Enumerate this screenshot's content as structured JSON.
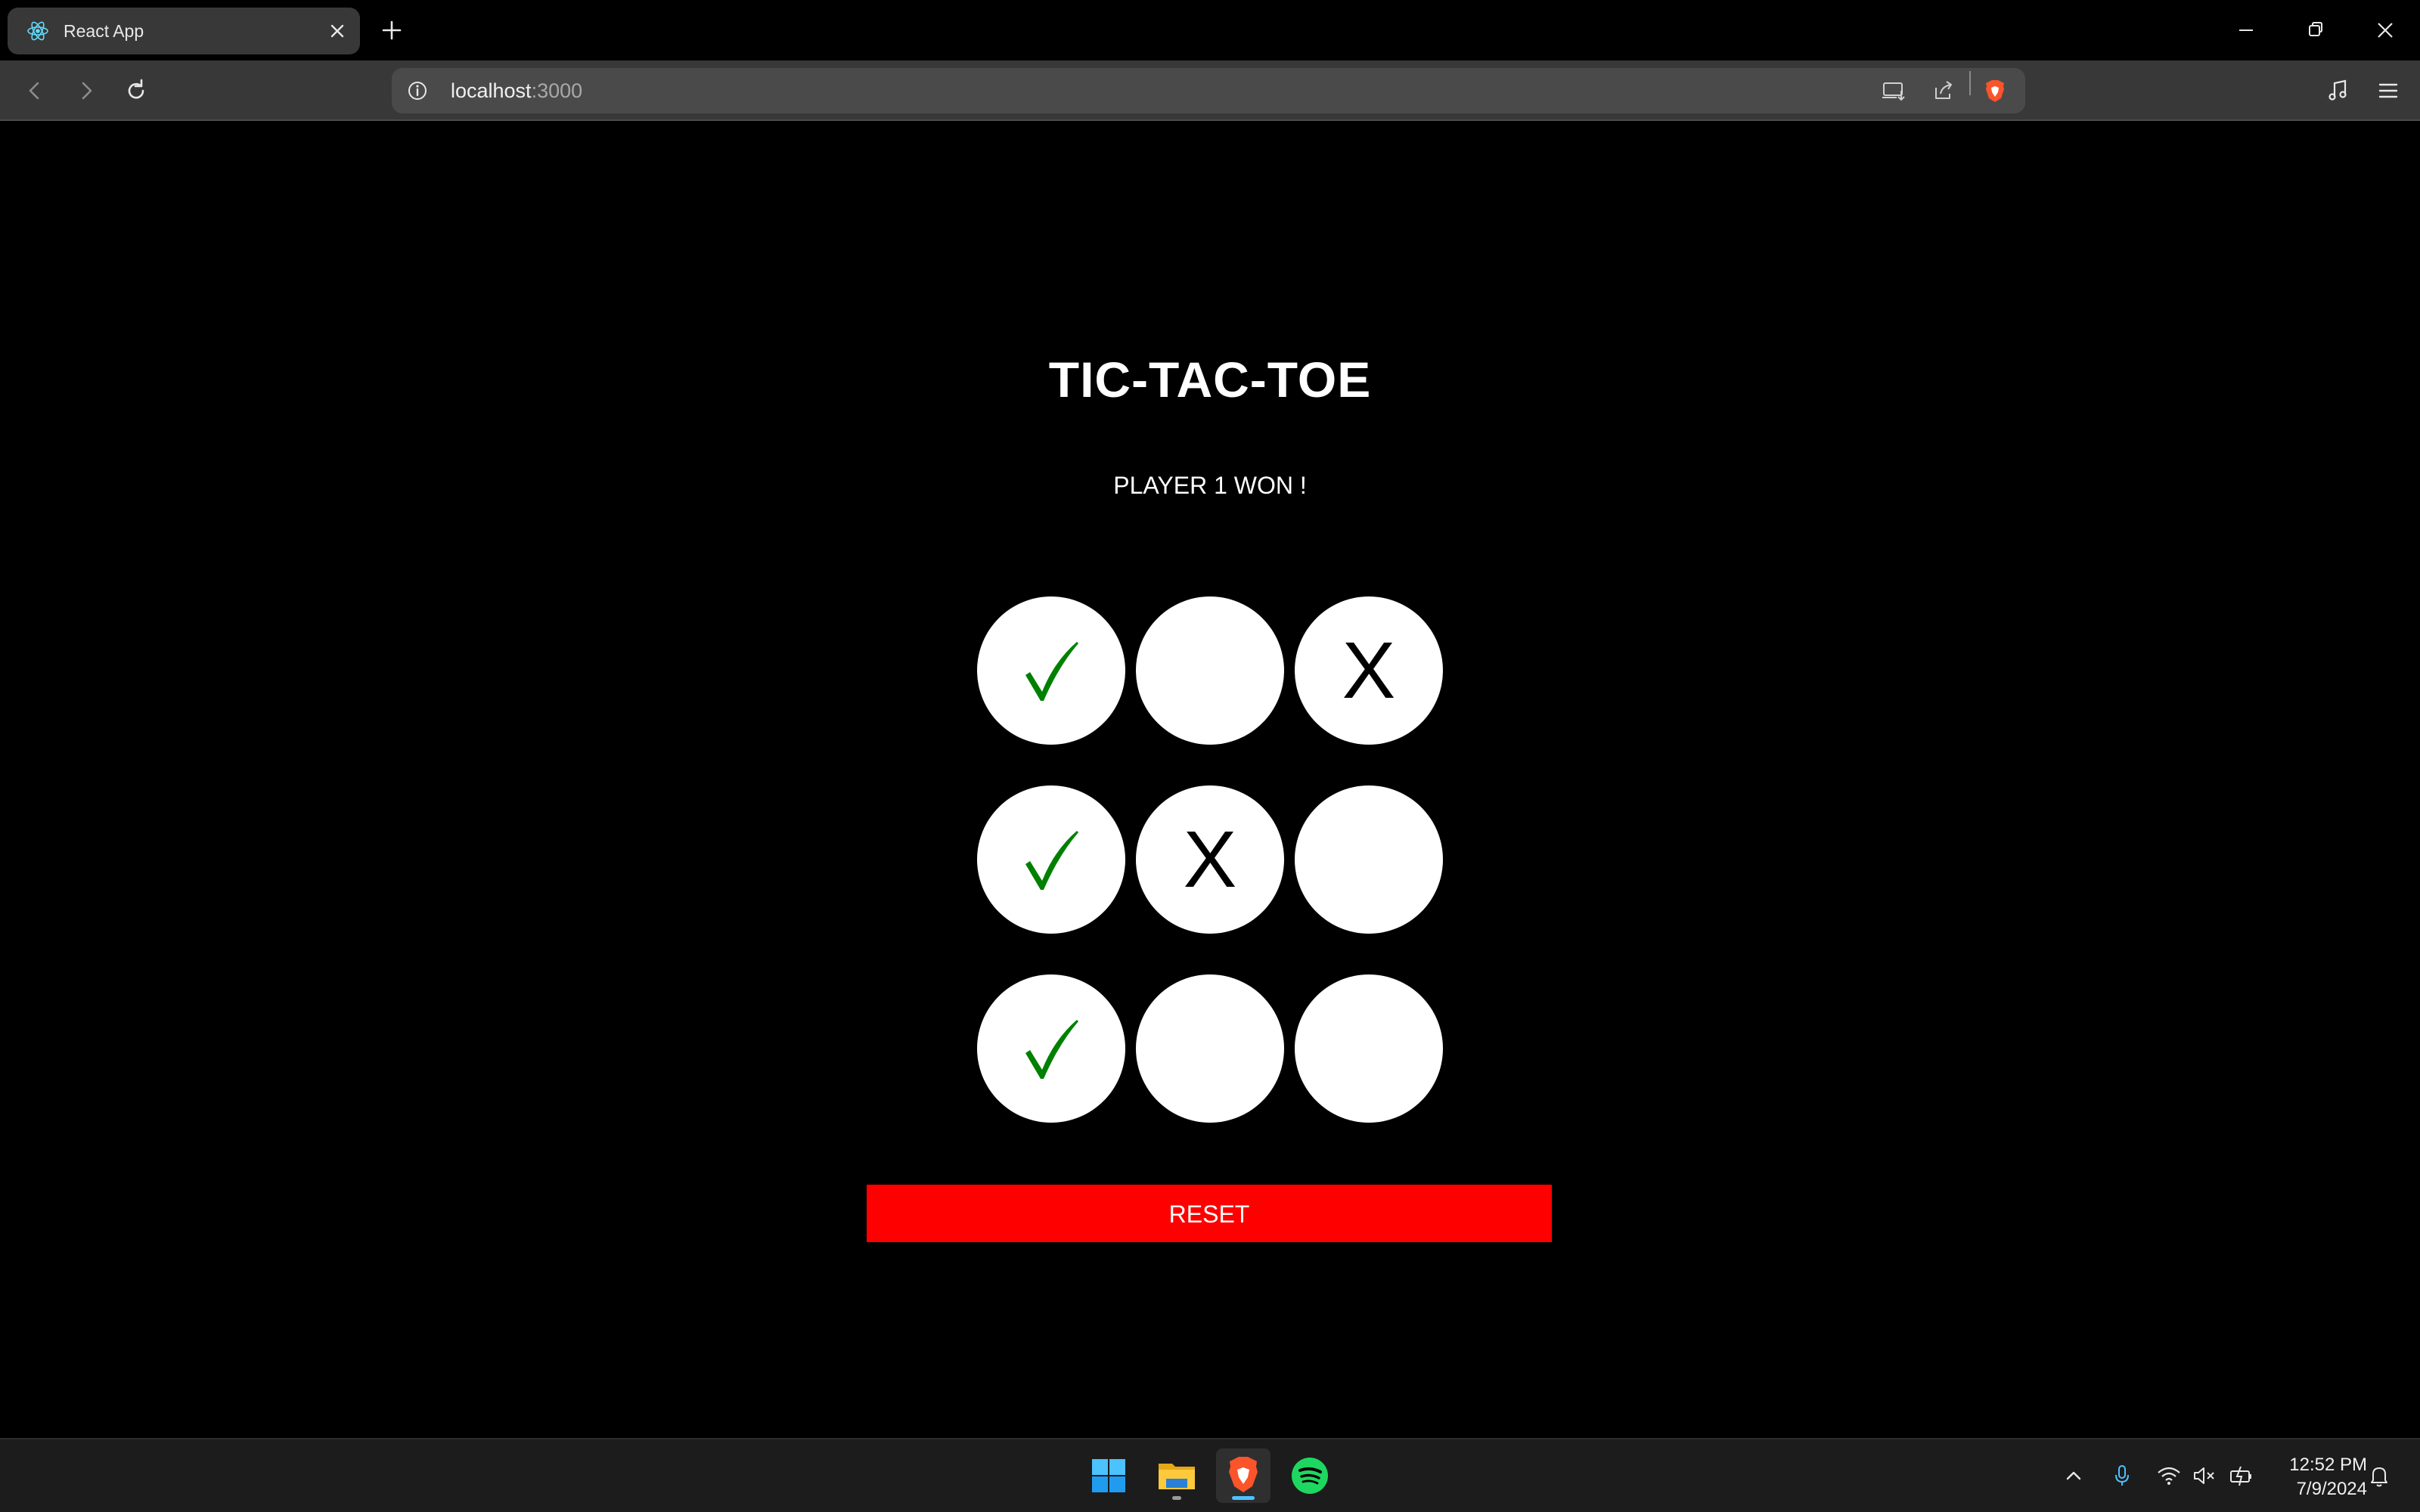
{
  "browser": {
    "tab": {
      "title": "React App"
    },
    "address_bar": {
      "host": "localhost",
      "port": ":3000"
    }
  },
  "game": {
    "title": "TIC-TAC-TOE",
    "status": "PLAYER 1 WON !",
    "board": [
      [
        "check",
        "",
        "X"
      ],
      [
        "check",
        "X",
        ""
      ],
      [
        "check",
        "",
        ""
      ]
    ],
    "reset_label": "RESET",
    "colors": {
      "check": "#008000",
      "reset": "#ff0000",
      "cell": "#ffffff"
    }
  },
  "taskbar": {
    "apps": [
      "windows-start-icon",
      "file-explorer-icon",
      "brave-browser-icon",
      "spotify-icon"
    ],
    "clock": {
      "time": "12:52 PM",
      "date": "7/9/2024"
    }
  }
}
